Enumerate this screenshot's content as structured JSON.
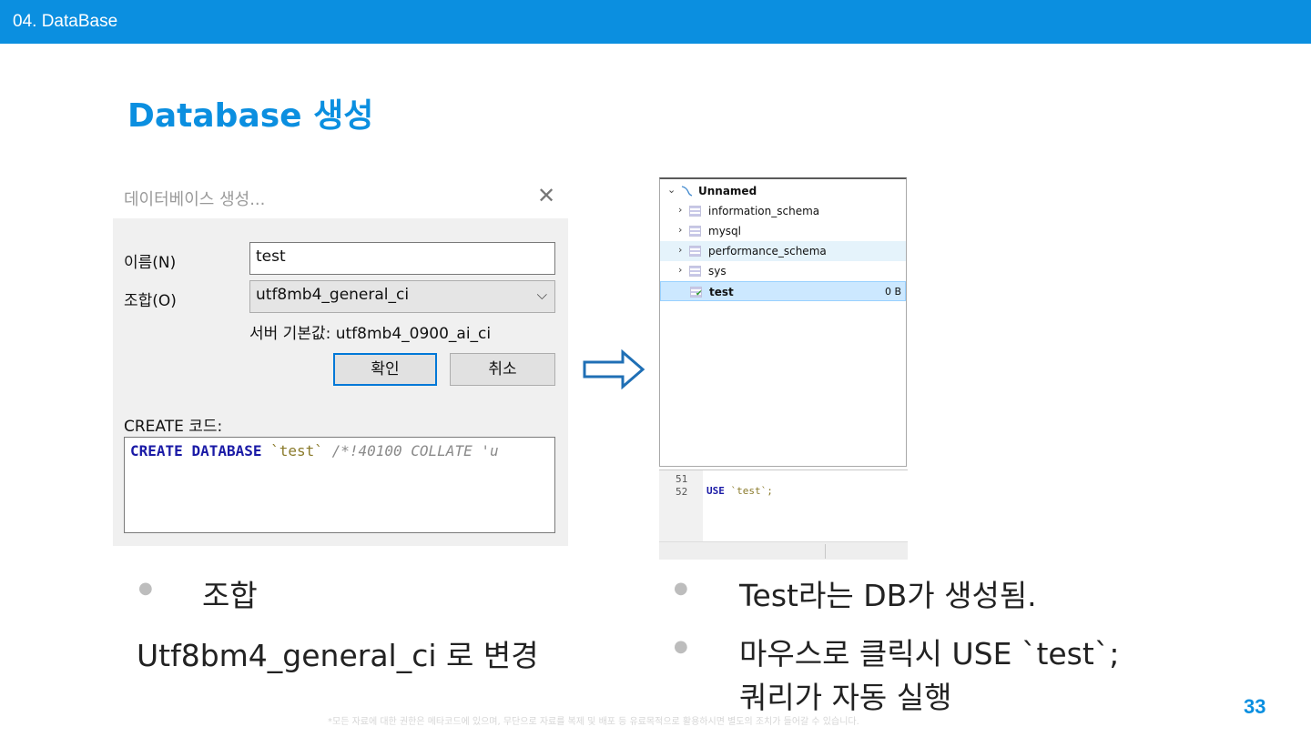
{
  "header": {
    "section": "04. DataBase"
  },
  "title": "Database 생성",
  "dialog": {
    "title": "데이터베이스 생성...",
    "close_icon": "close-icon",
    "name_label": "이름(N)",
    "name_value": "test",
    "collation_label": "조합(O)",
    "collation_value": "utf8mb4_general_ci",
    "server_default": "서버 기본값: utf8mb4_0900_ai_ci",
    "ok_button": "확인",
    "cancel_button": "취소",
    "create_code_label": "CREATE 코드:",
    "create_code": {
      "kw1": "CREATE",
      "kw2": "DATABASE",
      "name": "`test`",
      "comment": "/*!40100 COLLATE 'u"
    }
  },
  "tree": {
    "root": "Unnamed",
    "items": [
      {
        "label": "information_schema",
        "size": ""
      },
      {
        "label": "mysql",
        "size": ""
      },
      {
        "label": "performance_schema",
        "size": ""
      },
      {
        "label": "sys",
        "size": ""
      },
      {
        "label": "test",
        "size": "0 B"
      }
    ]
  },
  "editor": {
    "line_numbers": [
      "51",
      "52"
    ],
    "keyword": "USE",
    "target": "`test`;"
  },
  "left_bullets": {
    "item1": "조합",
    "item1_detail": "Utf8bm4_general_ci 로 변경"
  },
  "right_bullets": {
    "item1": "Test라는 DB가 생성됨.",
    "item2_line1": "마우스로 클릭시 USE `test`;",
    "item2_line2": "쿼리가 자동 실행"
  },
  "footer": {
    "note": "*모든 자료에 대한 권한은 메타코드에 있으며, 무단으로 자료를 복제 및 배포 등 유료목적으로 활용하시면 별도의 조치가 들어갈 수 있습니다.",
    "page_number": "33"
  },
  "colors": {
    "accent": "#0b8fe0",
    "selection": "#cce8ff"
  }
}
